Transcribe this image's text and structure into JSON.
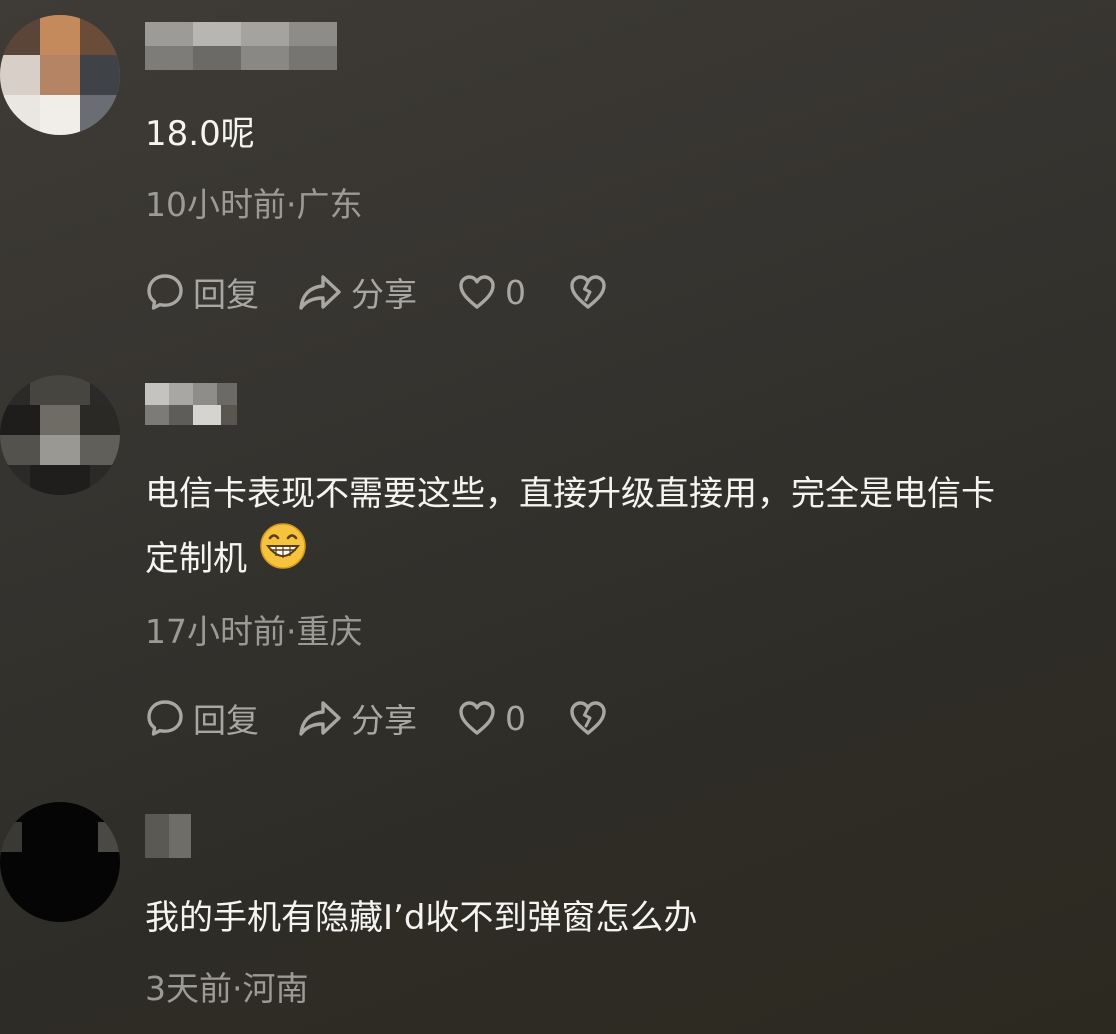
{
  "comments": [
    {
      "text": "18.0呢",
      "meta": "10小时前·广东",
      "actions": {
        "reply": "回复",
        "share": "分享",
        "like_count": "0"
      }
    },
    {
      "text_line1": "电信卡表现不需要这些，直接升级直接用，完全是电信卡",
      "text_line2": "定制机",
      "emoji": "grinning-face-emoji",
      "meta": "17小时前·重庆",
      "actions": {
        "reply": "回复",
        "share": "分享",
        "like_count": "0"
      }
    },
    {
      "text": "我的手机有隐藏I’d收不到弹窗怎么办",
      "meta": "3天前·河南"
    }
  ],
  "icons": [
    "comment-bubble-icon",
    "share-arrow-icon",
    "heart-icon",
    "broken-heart-icon"
  ],
  "colors": {
    "background": "#363430",
    "text": "#f4f4f2",
    "meta": "#9c9a96",
    "action": "#a9a7a3"
  }
}
